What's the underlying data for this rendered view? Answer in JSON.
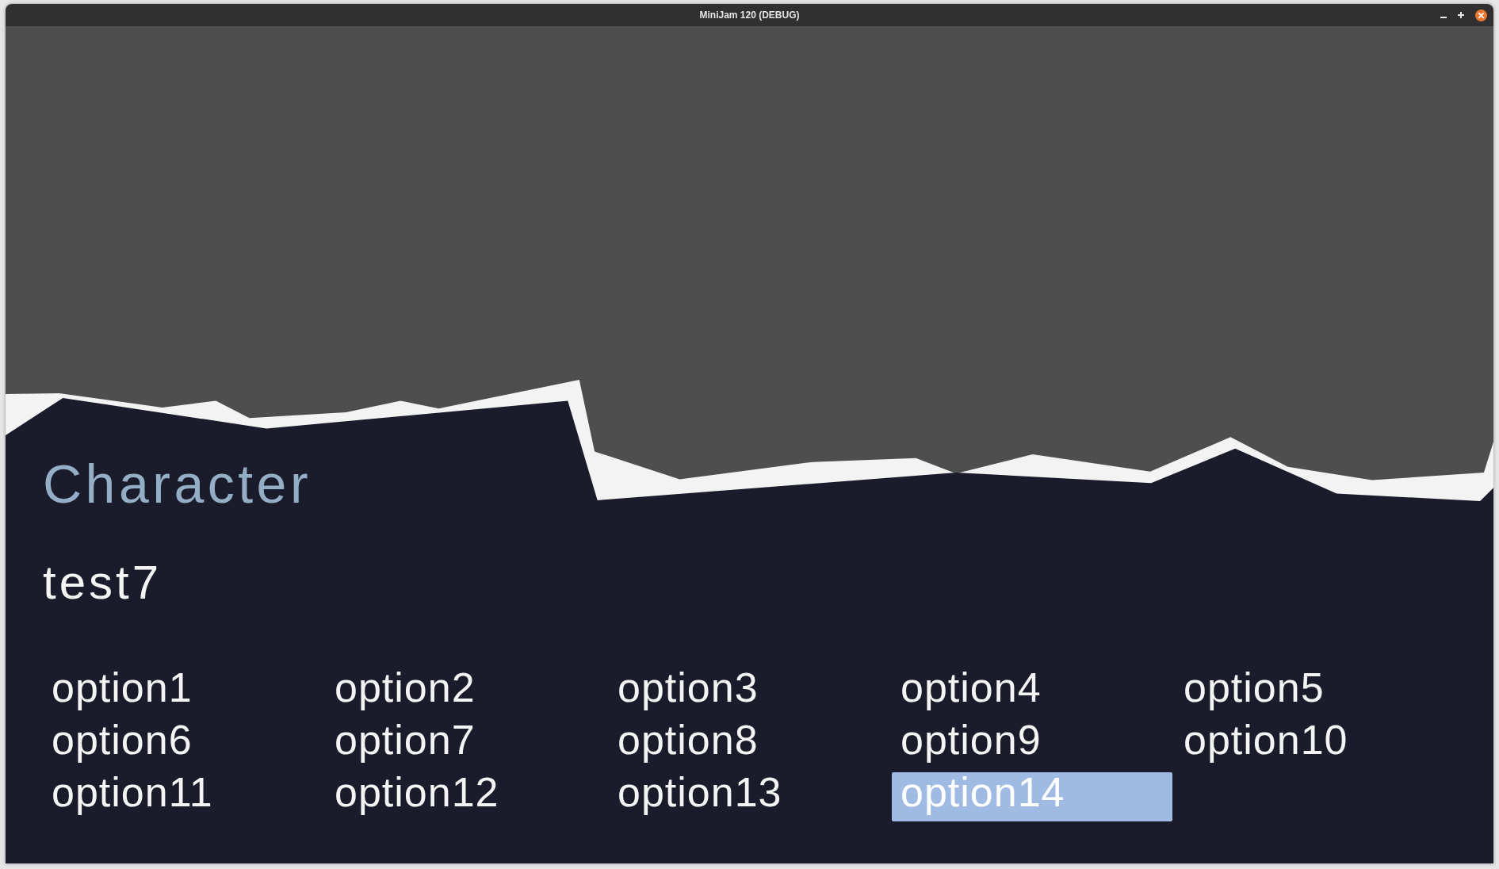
{
  "window": {
    "title": "MiniJam 120 (DEBUG)"
  },
  "screen": {
    "heading": "Character",
    "name": "test7",
    "options": [
      {
        "label": "option1",
        "selected": false
      },
      {
        "label": "option2",
        "selected": false
      },
      {
        "label": "option3",
        "selected": false
      },
      {
        "label": "option4",
        "selected": false
      },
      {
        "label": "option5",
        "selected": false
      },
      {
        "label": "option6",
        "selected": false
      },
      {
        "label": "option7",
        "selected": false
      },
      {
        "label": "option8",
        "selected": false
      },
      {
        "label": "option9",
        "selected": false
      },
      {
        "label": "option10",
        "selected": false
      },
      {
        "label": "option11",
        "selected": false
      },
      {
        "label": "option12",
        "selected": false
      },
      {
        "label": "option13",
        "selected": false
      },
      {
        "label": "option14",
        "selected": true
      }
    ]
  }
}
